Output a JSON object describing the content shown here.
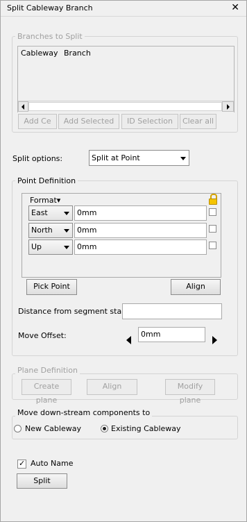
{
  "window": {
    "title": "Split Cableway Branch",
    "close_glyph": "✕"
  },
  "branches": {
    "legend": "Branches to Split",
    "columns": [
      "Cableway",
      "Branch"
    ],
    "buttons": {
      "add_ce": "Add Ce",
      "add_selected": "Add Selected",
      "id_selection": "ID Selection",
      "clear_all": "Clear all"
    }
  },
  "split_options": {
    "label": "Split options:",
    "value": "Split at Point"
  },
  "point_definition": {
    "legend": "Point Definition",
    "format_label": "Format▾",
    "rows": [
      {
        "axis": "East",
        "value": "0mm"
      },
      {
        "axis": "North",
        "value": "0mm"
      },
      {
        "axis": "Up",
        "value": "0mm"
      }
    ],
    "pick_point": "Pick Point",
    "align": "Align",
    "distance_label": "Distance from segment start:",
    "distance_value": "",
    "move_offset_label": "Move Offset:",
    "move_offset_value": "0mm"
  },
  "plane_definition": {
    "legend": "Plane Definition",
    "create_plane": "Create plane",
    "align": "Align",
    "modify_plane": "Modify plane"
  },
  "move_downstream": {
    "legend": "Move down-stream components to",
    "new_cableway": "New Cableway",
    "existing_cableway": "Existing Cableway",
    "selected": "existing"
  },
  "auto_name": {
    "label": "Auto Name",
    "checked": true
  },
  "split_button": "Split"
}
